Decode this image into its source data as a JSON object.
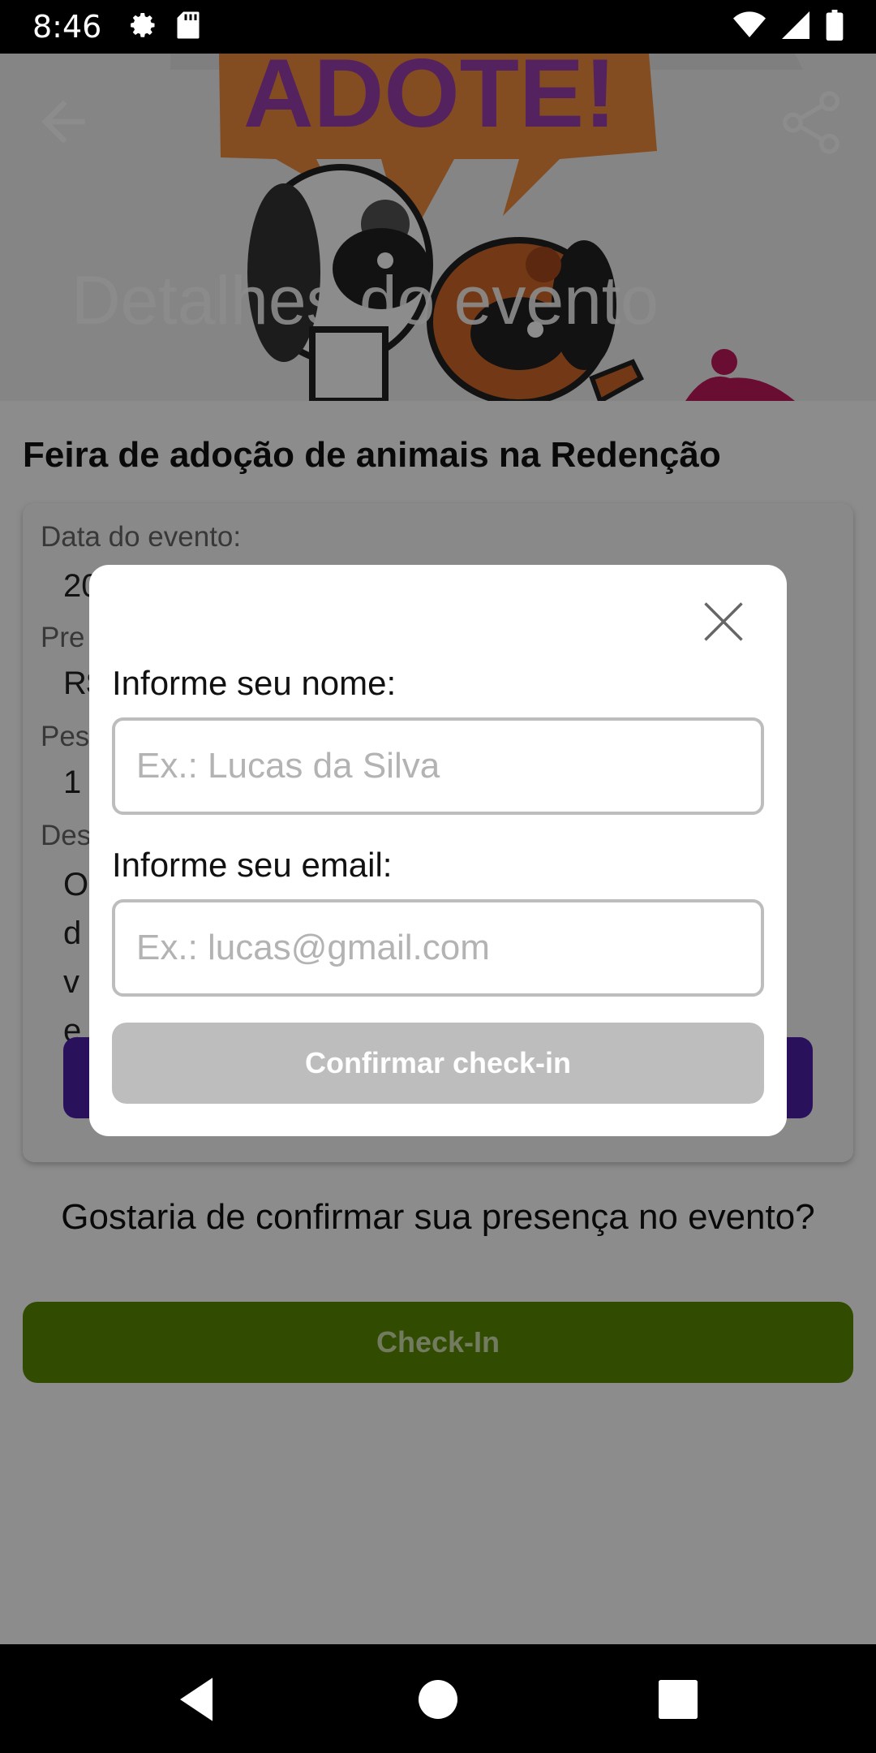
{
  "status_bar": {
    "time": "8:46",
    "icons": [
      "gear-icon",
      "sd-card-icon",
      "wifi-icon",
      "signal-icon",
      "battery-icon"
    ]
  },
  "header": {
    "title": "Detalhes do evento",
    "banner_text": "ADOTE!",
    "back_icon": "arrow-left-icon",
    "share_icon": "share-icon"
  },
  "event": {
    "name": "Feira de adoção de animais na Redenção",
    "date_label": "Data do evento:",
    "date_value": "20",
    "price_label": "Pre",
    "price_value": "R$",
    "people_label": "Pes",
    "people_value": "1",
    "description_label": "Des",
    "description_value": "O d ve"
  },
  "question": "Gostaria de confirmar sua presença no evento?",
  "checkin_button": "Check-In",
  "dialog": {
    "name_label": "Informe seu nome:",
    "name_placeholder": "Ex.: Lucas da Silva",
    "email_label": "Informe seu email:",
    "email_placeholder": "Ex.: lucas@gmail.com",
    "confirm_label": "Confirmar check-in",
    "close_icon": "close-icon"
  },
  "colors": {
    "accent_purple": "#4b1fa8",
    "checkin_green": "#5a8a00",
    "banner_orange": "#f08a3c",
    "banner_text_purple": "#9b3fb0"
  }
}
